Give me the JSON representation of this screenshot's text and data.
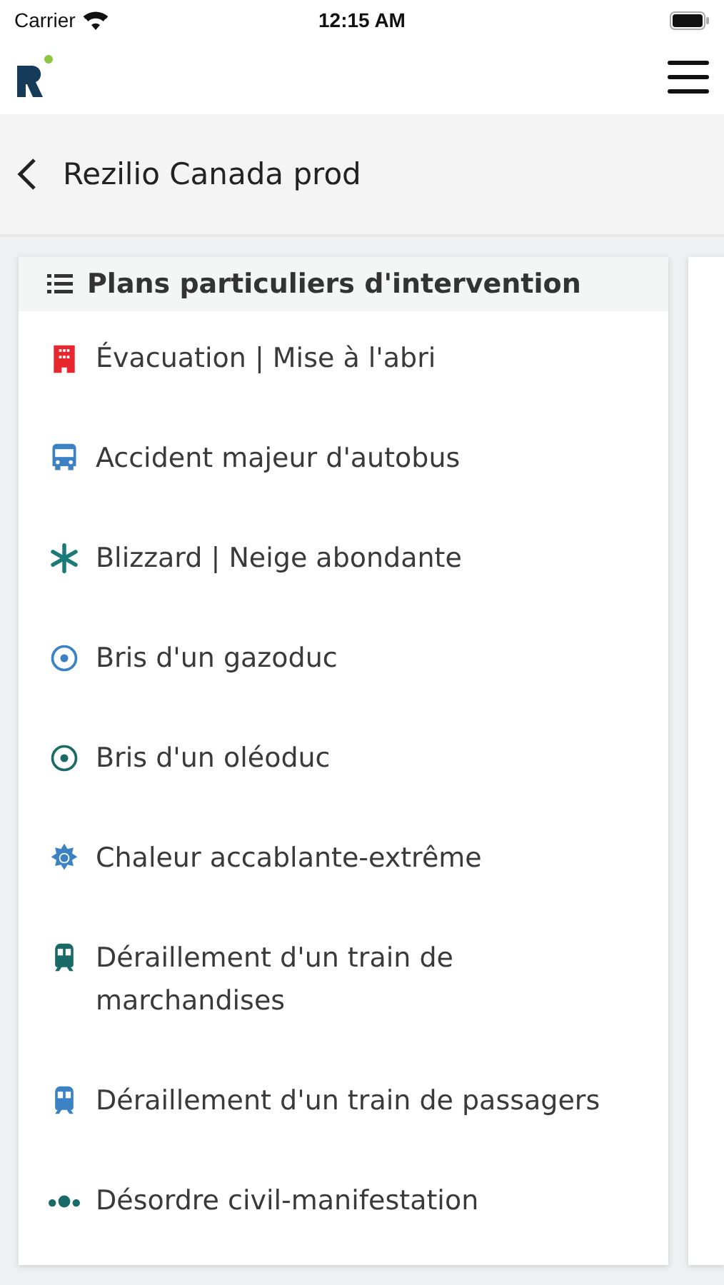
{
  "status_bar": {
    "carrier": "Carrier",
    "time": "12:15 AM"
  },
  "nav": {
    "title": "Rezilio Canada prod"
  },
  "card": {
    "title": "Plans particuliers d'intervention",
    "items": [
      {
        "label": "Évacuation | Mise à l'abri",
        "kind": "building",
        "color": "#e8262d"
      },
      {
        "label": "Accident majeur d'autobus",
        "kind": "bus",
        "color": "#3a82c4"
      },
      {
        "label": "Blizzard | Neige abondante",
        "kind": "snowflake",
        "color": "#1a7a78"
      },
      {
        "label": "Bris d'un gazoduc",
        "kind": "target",
        "color": "#3a82c4"
      },
      {
        "label": "Bris d'un oléoduc",
        "kind": "target",
        "color": "#1a6b68"
      },
      {
        "label": "Chaleur accablante-extrême",
        "kind": "sun",
        "color": "#3a82c4"
      },
      {
        "label": "Déraillement d'un train de marchandises",
        "kind": "train",
        "color": "#1a6b68"
      },
      {
        "label": "Déraillement d'un train de passagers",
        "kind": "train",
        "color": "#3a82c4"
      },
      {
        "label": "Désordre civil-manifestation",
        "kind": "people",
        "color": "#1a6b68"
      }
    ]
  }
}
